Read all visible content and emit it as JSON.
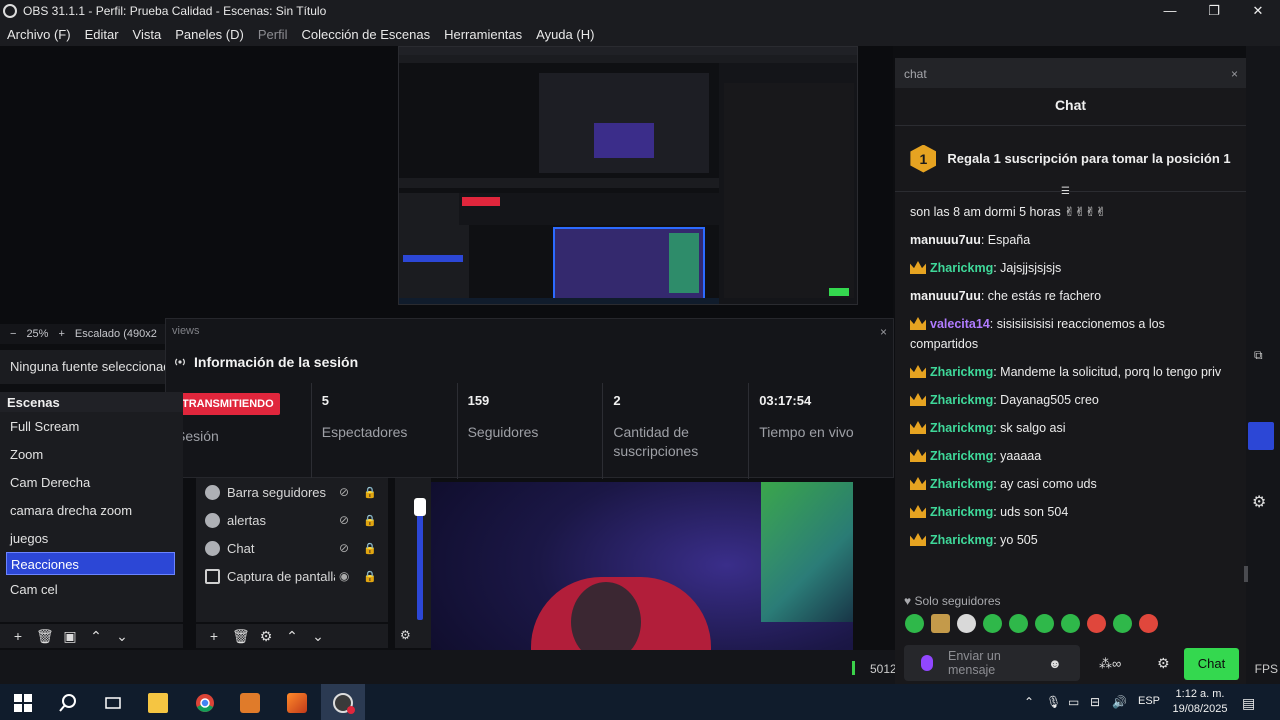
{
  "window": {
    "title": "OBS 31.1.1 - Perfil: Prueba Calidad - Escenas: Sin Título",
    "controls": [
      "—",
      "❐",
      "✕"
    ]
  },
  "menu": [
    "Archivo (F)",
    "Editar",
    "Vista",
    "Paneles (D)",
    "Perfil",
    "Colección de Escenas",
    "Herramientas",
    "Ayuda (H)"
  ],
  "preview": {
    "zoom": "25%",
    "scale_label": "Escalado (490x2",
    "no_source": "Ninguna fuente seleccionad"
  },
  "views": {
    "tab_label": "views",
    "title": "Información de la sesión",
    "stats": [
      {
        "value": "TRANSMITIENDO",
        "label": "Sesión"
      },
      {
        "value": "5",
        "label": "Espectadores"
      },
      {
        "value": "159",
        "label": "Seguidores"
      },
      {
        "value": "2",
        "label": "Cantidad de suscripciones"
      },
      {
        "value": "03:17:54",
        "label": "Tiempo en vivo"
      }
    ]
  },
  "scenes": {
    "title": "Escenas",
    "items": [
      "Full Scream",
      "Zoom",
      "Cam Derecha",
      "camara drecha zoom",
      "juegos",
      "Reacciones",
      "Cam cel"
    ],
    "selected": "Reacciones"
  },
  "sources": {
    "items": [
      {
        "name": "Barra seguidores",
        "visible": false
      },
      {
        "name": "alertas",
        "visible": false
      },
      {
        "name": "Chat",
        "visible": false
      },
      {
        "name": "Captura de pantalla",
        "visible": true
      }
    ]
  },
  "status": {
    "bitrate_partial": "5012",
    "fps_partial": "FPS"
  },
  "chat": {
    "tab_label": "chat",
    "title": "Chat",
    "pinned": {
      "rank": "1",
      "text": "Regala 1 suscripción para tomar la posición 1"
    },
    "messages": [
      {
        "user": "",
        "text": "son las 8 am dormi 5 horas ✌✌✌✌",
        "badge": false,
        "color": "w"
      },
      {
        "user": "manuuu7uu",
        "text": ": España",
        "badge": false,
        "color": "w"
      },
      {
        "user": "Zharickmg",
        "text": ": Jajsjjsjsjsjs",
        "badge": true,
        "color": "g"
      },
      {
        "user": "manuuu7uu",
        "text": ": che estás re fachero",
        "badge": false,
        "color": "w"
      },
      {
        "user": "valecita14",
        "text": ": sisisiisisisi reaccionemos a los compartidos",
        "badge": true,
        "color": "p"
      },
      {
        "user": "Zharickmg",
        "text": ": Mandeme la solicitud, porq lo tengo priv",
        "badge": true,
        "color": "g"
      },
      {
        "user": "Zharickmg",
        "text": ": Dayanag505 creo",
        "badge": true,
        "color": "g"
      },
      {
        "user": "Zharickmg",
        "text": ": sk salgo asi",
        "badge": true,
        "color": "g"
      },
      {
        "user": "Zharickmg",
        "text": ": yaaaaa",
        "badge": true,
        "color": "g"
      },
      {
        "user": "Zharickmg",
        "text": ": ay casi como uds",
        "badge": true,
        "color": "g"
      },
      {
        "user": "Zharickmg",
        "text": ": uds son 504",
        "badge": true,
        "color": "g"
      },
      {
        "user": "Zharickmg",
        "text": ": yo 505",
        "badge": true,
        "color": "g"
      }
    ],
    "followers_only": "Solo seguidores",
    "input_placeholder": "Enviar un mensaje",
    "send_label": "Chat"
  },
  "taskbar": {
    "lang": "ESP",
    "time": "1:12 a. m.",
    "date": "19/08/2025"
  },
  "colors": {
    "accent": "#2c47d6",
    "live": "#e0263c",
    "chat_green": "#3fd99a",
    "send_green": "#34d84f",
    "gold": "#e6a321"
  }
}
